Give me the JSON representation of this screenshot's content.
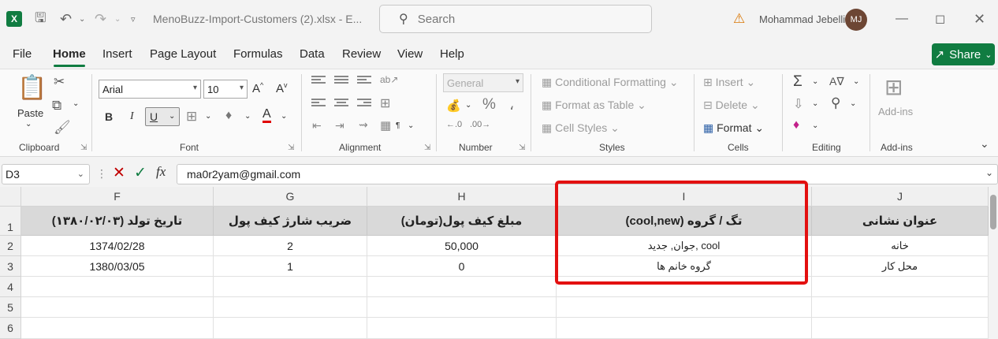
{
  "titlebar": {
    "doc_title": "MenoBuzz-Import-Customers (2).xlsx  -  E...",
    "search_placeholder": "Search",
    "user_name": "Mohammad Jebelli",
    "user_initials": "MJ"
  },
  "menu": {
    "items": [
      "File",
      "Home",
      "Insert",
      "Page Layout",
      "Formulas",
      "Data",
      "Review",
      "View",
      "Help"
    ],
    "active": "Home",
    "share_label": "Share"
  },
  "ribbon": {
    "clipboard": {
      "paste": "Paste",
      "label": "Clipboard"
    },
    "font": {
      "name": "Arial",
      "size": "10",
      "label": "Font",
      "bold": "B",
      "italic": "I",
      "underline": "U"
    },
    "alignment": {
      "label": "Alignment"
    },
    "number": {
      "format": "General",
      "label": "Number"
    },
    "styles": {
      "conditional": "Conditional Formatting",
      "format_table": "Format as Table",
      "cell_styles": "Cell Styles",
      "label": "Styles"
    },
    "cells": {
      "insert": "Insert",
      "delete": "Delete",
      "format": "Format",
      "label": "Cells"
    },
    "editing": {
      "label": "Editing"
    },
    "addins": {
      "button": "Add-ins",
      "label": "Add-ins"
    }
  },
  "formula_bar": {
    "name_box": "D3",
    "formula": "ma0r2yam@gmail.com"
  },
  "sheet": {
    "columns": [
      "F",
      "G",
      "H",
      "I",
      "J"
    ],
    "rows": [
      "1",
      "2",
      "3",
      "4",
      "5",
      "6"
    ],
    "header_row": [
      "تاریخ تولد (۱۳۸۰/۰۲/۰۳)",
      "ضریب شارژ کیف پول",
      "مبلغ کیف پول(تومان)",
      "تگ / گروه (cool,new)",
      "عنوان نشانی"
    ],
    "data_rows": [
      [
        "1374/02/28",
        "2",
        "50,000",
        "cool ,جوان, جدید",
        "خانه"
      ],
      [
        "1380/03/05",
        "1",
        "0",
        "گروه خانم ها",
        "محل کار"
      ]
    ]
  }
}
